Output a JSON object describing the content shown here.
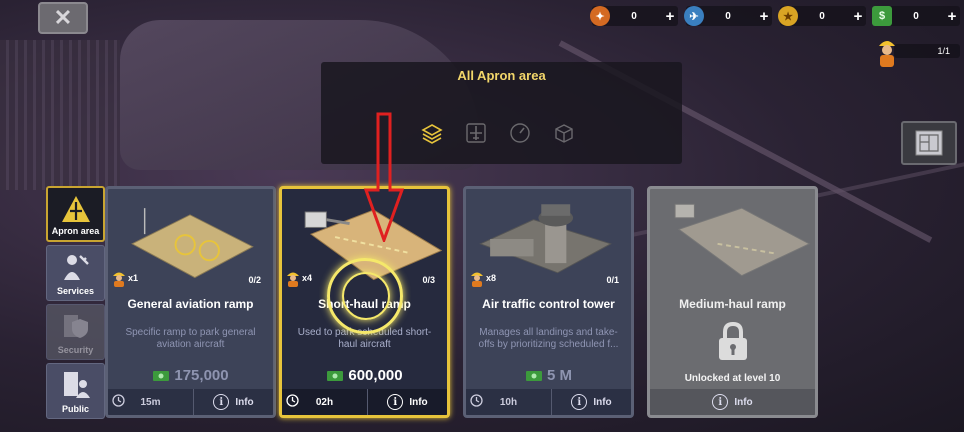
{
  "close": {
    "label": "close",
    "icon": "close-icon"
  },
  "resources": [
    {
      "icon": "shield-star-icon",
      "value": "0",
      "color": "#d46a22",
      "glyph": "✦"
    },
    {
      "icon": "plane-badge-icon",
      "value": "0",
      "color": "#3a7fbf",
      "glyph": "✈"
    },
    {
      "icon": "gold-coin-icon",
      "value": "0",
      "color": "#d9a424",
      "glyph": "★"
    },
    {
      "icon": "cash-icon",
      "value": "0",
      "color": "#3c9a3c",
      "glyph": "$"
    }
  ],
  "workers_counter": {
    "value": "1/1",
    "icon": "worker-icon"
  },
  "tooltip": {
    "title": "All Apron area",
    "filters": [
      "stack-icon",
      "plane-icon",
      "gauge-icon",
      "box-icon"
    ],
    "active_filter": 0
  },
  "side_tabs": [
    {
      "label": "Apron area",
      "icon": "apron-icon",
      "state": "active"
    },
    {
      "label": "Services",
      "icon": "services-icon",
      "state": "normal"
    },
    {
      "label": "Security",
      "icon": "security-icon",
      "state": "disabled"
    },
    {
      "label": "Public",
      "icon": "public-icon",
      "state": "normal"
    }
  ],
  "cards": [
    {
      "name": "General aviation ramp",
      "workers": "x1",
      "owned": "0/2",
      "desc": "Specific ramp to park general aviation aircraft",
      "price": "175,000",
      "time": "15m",
      "info": "Info",
      "state": "normal"
    },
    {
      "name": "Short-haul ramp",
      "workers": "x4",
      "owned": "0/3",
      "desc": "Used to park scheduled short-haul aircraft",
      "price": "600,000",
      "time": "02h",
      "info": "Info",
      "state": "selected"
    },
    {
      "name": "Air traffic control tower",
      "workers": "x8",
      "owned": "0/1",
      "desc": "Manages all landings and take-offs by prioritizing scheduled f...",
      "price": "5 M",
      "time": "10h",
      "info": "Info",
      "state": "normal"
    },
    {
      "name": "Medium-haul ramp",
      "unlock": "Unlocked at level 10",
      "info": "Info",
      "state": "locked"
    }
  ],
  "colors": {
    "accent": "#e7c43b",
    "panel": "#3d4358",
    "tooltip_title": "#f2d66a",
    "arrow": "#e02020"
  }
}
